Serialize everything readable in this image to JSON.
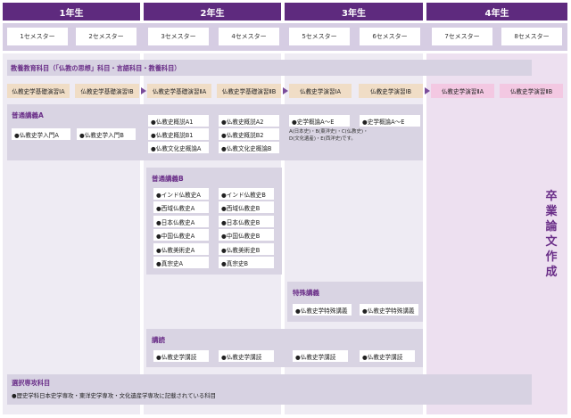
{
  "years": [
    "1年生",
    "2年生",
    "3年生",
    "4年生"
  ],
  "semesters": [
    "1セメスター",
    "2セメスター",
    "3セメスター",
    "4セメスター",
    "5セメスター",
    "6セメスター",
    "7セメスター",
    "8セメスター"
  ],
  "liberal": {
    "title": "教養教育科目（「仏教の思想」科目・言語科目・教養科目）",
    "courses": [
      "仏教史学基礎演習ⅠA",
      "仏教史学基礎演習ⅠB",
      "仏教史学基礎演習ⅡA",
      "仏教史学基礎演習ⅡB",
      "仏教史学演習ⅠA",
      "仏教史学演習ⅠB",
      "仏教史学演習ⅡA",
      "仏教史学演習ⅡB"
    ]
  },
  "general_a": {
    "title": "普通講義A",
    "sem1": "●仏教史学入門A",
    "sem2": "●仏教史学入門B",
    "sem3": [
      "●仏教史概説A1",
      "●仏教史概説B1",
      "●仏教文化史概論A"
    ],
    "sem4": [
      "●仏教史概説A2",
      "●仏教史概説B2",
      "●仏教文化史概論B"
    ],
    "sem5": "●史学概論A～E",
    "sem6": "●史学概論A～E",
    "note": [
      "A(日本史)・B(東洋史)・C(仏教史)・",
      "D(文化遺産)・E(西洋史)です。"
    ]
  },
  "general_b": {
    "title": "普通講義B",
    "left": [
      "●インド仏教史A",
      "●西域仏教史A",
      "●日本仏教史A",
      "●中国仏教史A",
      "●仏教美術史A",
      "●真宗史A"
    ],
    "right": [
      "●インド仏教史B",
      "●西域仏教史B",
      "●日本仏教史B",
      "●中国仏教史B",
      "●仏教美術史B",
      "●真宗史B"
    ]
  },
  "special": {
    "title": "特殊講義",
    "items": [
      "●仏教史学特殊講義",
      "●仏教史学特殊講義"
    ]
  },
  "reading": {
    "title": "講読",
    "items": [
      "●仏教史学講読",
      "●仏教史学講読",
      "●仏教史学講読",
      "●仏教史学講読"
    ]
  },
  "thesis": [
    "卒",
    "業",
    "論",
    "文",
    "作",
    "成"
  ],
  "elective": {
    "title": "選択専攻科目",
    "text": "●歴史学科日本史学専攻・東洋史学専攻・文化遺産学専攻に記載されている科目"
  },
  "colors": {
    "header": "#5e2a7e",
    "accent": "#6a2e88",
    "chip": "#f0ddc6",
    "chip_final": "#f3c8e2"
  }
}
